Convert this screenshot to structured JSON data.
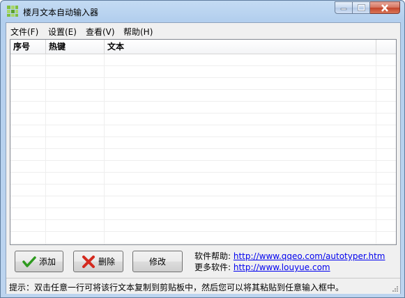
{
  "window": {
    "title": "楼月文本自动输入器"
  },
  "menu": [
    "文件(F)",
    "设置(E)",
    "查看(V)",
    "帮助(H)"
  ],
  "list": {
    "columns": [
      "序号",
      "热键",
      "文本"
    ],
    "rows": []
  },
  "buttons": {
    "add": "添加",
    "delete": "删除",
    "modify": "修改"
  },
  "links": {
    "help_label": "软件帮助:",
    "help_url": "http://www.qqeo.com/autotyper.htm",
    "more_label": "更多软件:",
    "more_url": "http://www.louyue.com"
  },
  "status": "提示：双击任意一行可将该行文本复制到剪贴板中，然后您可以将其粘贴到任意输入框中。"
}
